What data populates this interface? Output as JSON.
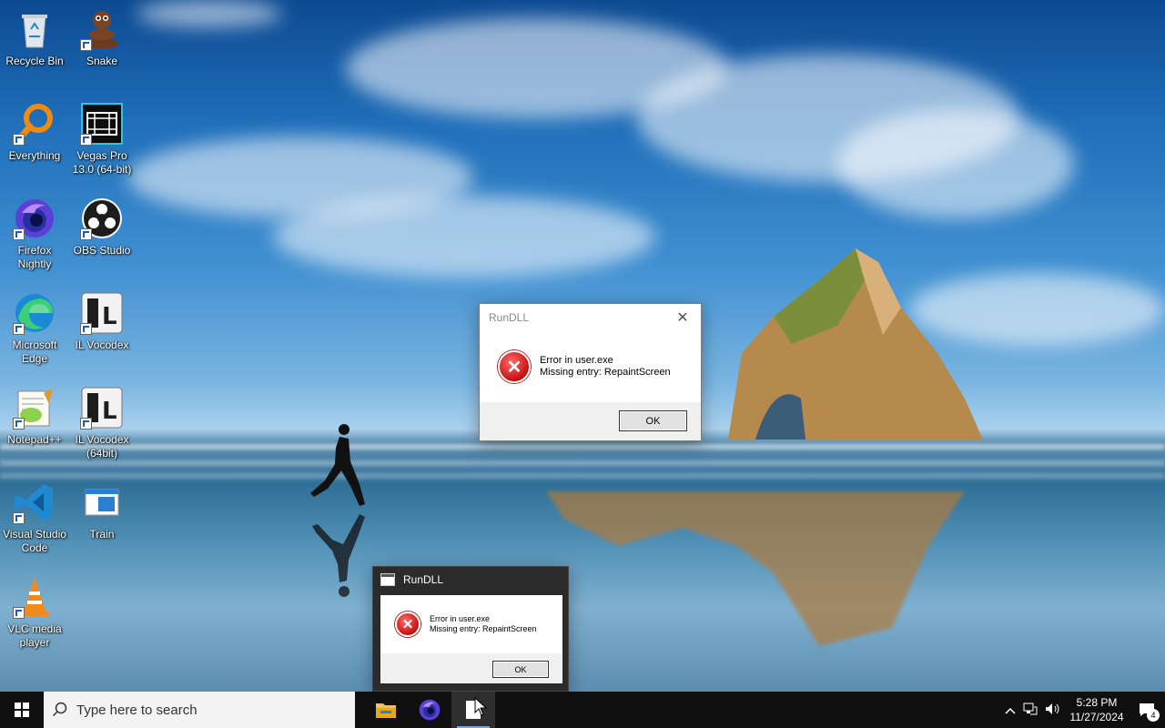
{
  "desktop": {
    "icons": [
      {
        "label": "Recycle Bin"
      },
      {
        "label": "Snake"
      },
      {
        "label": "Everything"
      },
      {
        "label": "Vegas Pro 13.0 (64-bit)"
      },
      {
        "label": "Firefox Nightly"
      },
      {
        "label": "OBS Studio"
      },
      {
        "label": "Microsoft Edge"
      },
      {
        "label": "IL Vocodex"
      },
      {
        "label": "Notepad++"
      },
      {
        "label": "IL Vocodex (64bit)"
      },
      {
        "label": "Visual Studio Code"
      },
      {
        "label": "Train"
      },
      {
        "label": "VLC media player"
      }
    ]
  },
  "dialog_main": {
    "title": "RunDLL",
    "close_glyph": "✕",
    "message_line1": "Error in user.exe",
    "message_line2": "Missing entry: RepaintScreen",
    "ok_label": "OK",
    "icon": "error-icon"
  },
  "dialog_preview": {
    "title": "RunDLL",
    "message_line1": "Error in user.exe",
    "message_line2": "Missing entry: RepaintScreen",
    "ok_label": "OK",
    "icon": "error-icon"
  },
  "taskbar": {
    "search_placeholder": "Type here to search",
    "apps": [
      "file-explorer-icon",
      "firefox-nightly-icon",
      "rundll-icon"
    ],
    "clock_time": "5:28 PM",
    "clock_date": "11/27/2024",
    "notification_count": "4",
    "accent_color": "#7aa8d8"
  }
}
